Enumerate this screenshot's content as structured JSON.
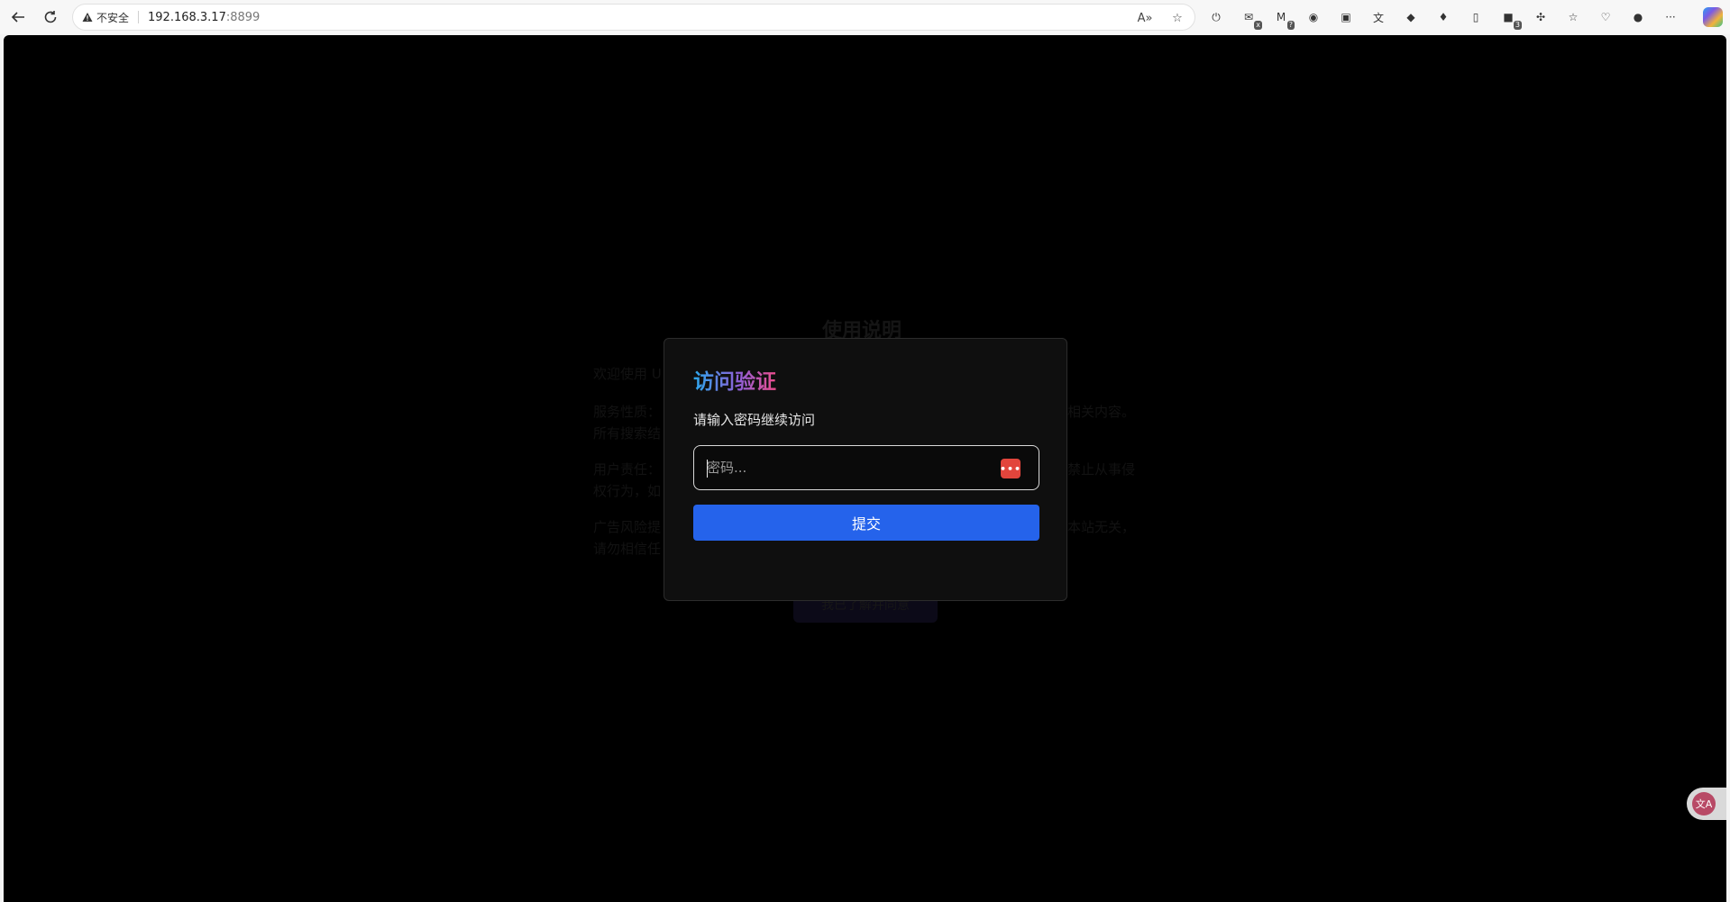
{
  "browser": {
    "security_label": "不安全",
    "url_host": "192.168.3.17",
    "url_port": ":8899",
    "read_aloud_icon": "A»",
    "favorite_icon": "☆",
    "extensions": [
      {
        "name": "power-icon",
        "glyph": "⏻"
      },
      {
        "name": "mail-x-icon",
        "glyph": "✉",
        "badge": "x"
      },
      {
        "name": "gmail-icon",
        "glyph": "M",
        "badge": "?"
      },
      {
        "name": "cookie-icon",
        "glyph": "◉"
      },
      {
        "name": "bilibili-icon",
        "glyph": "▣"
      },
      {
        "name": "translate-ext-icon",
        "glyph": "文"
      },
      {
        "name": "globe-ext-icon",
        "glyph": "◆"
      },
      {
        "name": "crystal-icon",
        "glyph": "♦"
      },
      {
        "name": "mouse-icon",
        "glyph": "▯"
      },
      {
        "name": "red-ext-icon",
        "glyph": "■",
        "badge": "3"
      },
      {
        "name": "puzzle-icon",
        "glyph": "✣"
      },
      {
        "name": "favorites-icon",
        "glyph": "☆"
      },
      {
        "name": "health-icon",
        "glyph": "♡"
      },
      {
        "name": "profile-avatar-icon",
        "glyph": "●"
      },
      {
        "name": "more-menu-icon",
        "glyph": "···"
      }
    ]
  },
  "background_page": {
    "title": "使用说明",
    "paragraphs": [
      "欢迎使用 U",
      "服务性质：",
      "所有搜索结",
      "用户责任：",
      "权行为，如",
      "广告风险提",
      "请勿相信任"
    ],
    "right_fragments": [
      "相关内容。",
      "禁止从事侵",
      "本站无关，"
    ],
    "button": "我已了解并同意"
  },
  "modal": {
    "title": "访问验证",
    "subtitle": "请输入密码继续访问",
    "password_placeholder": "密码...",
    "password_manager_icon": "•••",
    "submit_label": "提交"
  },
  "float_widget": {
    "label": "文A"
  }
}
